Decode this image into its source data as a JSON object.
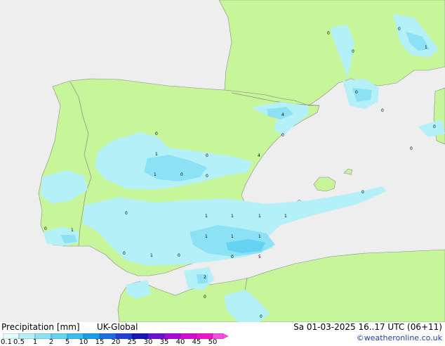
{
  "legend": {
    "title": "Precipitation [mm]",
    "model": "UK-Global",
    "scale_labels": [
      "0.1",
      "0.5",
      "1",
      "2",
      "5",
      "10",
      "15",
      "20",
      "25",
      "30",
      "35",
      "40",
      "45",
      "50"
    ],
    "scale_colors": [
      "#e0fcfc",
      "#b4f0f8",
      "#8ce2f4",
      "#64d2f0",
      "#3cbceb",
      "#1b9ee6",
      "#1d6ee0",
      "#1f3edb",
      "#1414b8",
      "#6c10d4",
      "#a40cd8",
      "#d40ad4",
      "#ee14c8",
      "#f050e0"
    ]
  },
  "valid_time": "Sa 01-03-2025 16..17 UTC (06+11)",
  "credit": "©weatheronline.co.uk",
  "colors": {
    "land": "#c6f59a",
    "sea": "#eeeeee",
    "border": "#8a8a8a",
    "precip_light": "#b4f0f8",
    "precip_mid": "#8ce2f4",
    "precip_heavy": "#64d2f0"
  },
  "map": {
    "point_values": [
      "0",
      "0",
      "1",
      "0",
      "0",
      "0",
      "4",
      "0",
      "0",
      "0",
      "1",
      "0",
      "4",
      "1",
      "0",
      "0",
      "0",
      "0",
      "0",
      "1",
      "1",
      "1",
      "1",
      "0",
      "1",
      "1",
      "1",
      "1",
      "0",
      "1",
      "0",
      "0",
      "5",
      "2",
      "0",
      "0"
    ]
  }
}
